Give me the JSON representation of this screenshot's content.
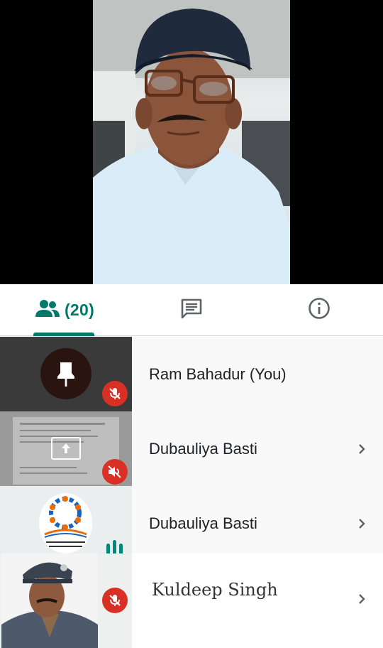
{
  "tabs": {
    "people_count": "(20)",
    "people_icon": "people-icon",
    "chat_icon": "chat-icon",
    "info_icon": "info-icon",
    "active_color": "#00796b"
  },
  "participants": [
    {
      "name": "Ram Bahadur (You)",
      "thumb": "avatar-placeholder",
      "status": "muted",
      "has_chevron": false
    },
    {
      "name": "Dubauliya Basti",
      "thumb": "screen-share-preview",
      "status": "audio-off",
      "has_chevron": true
    },
    {
      "name": "Dubauliya Basti",
      "thumb": "logo",
      "status": "speaking",
      "has_chevron": true
    },
    {
      "name": "Kuldeep Singh",
      "thumb": "photo",
      "status": "muted",
      "has_chevron": true
    }
  ],
  "colors": {
    "mute_red": "#d93025",
    "speaking_teal": "#00897b"
  }
}
